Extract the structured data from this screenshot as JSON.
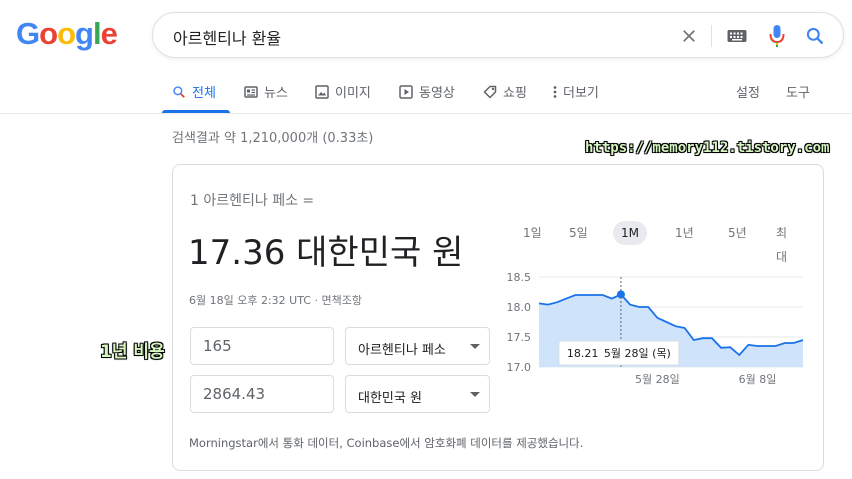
{
  "logo": {
    "letters": [
      "G",
      "o",
      "o",
      "g",
      "l",
      "e"
    ],
    "colors": [
      "#4285f4",
      "#ea4335",
      "#fbbc05",
      "#4285f4",
      "#34a853",
      "#ea4335"
    ]
  },
  "search": {
    "query": "아르헨티나 환율"
  },
  "tabs": [
    {
      "label": "전체",
      "icon": "search-icon",
      "active": true
    },
    {
      "label": "뉴스",
      "icon": "news-icon"
    },
    {
      "label": "이미지",
      "icon": "image-icon"
    },
    {
      "label": "동영상",
      "icon": "video-icon"
    },
    {
      "label": "쇼핑",
      "icon": "tag-icon"
    },
    {
      "label": "더보기",
      "icon": "more-vert-icon"
    },
    {
      "label": "설정"
    },
    {
      "label": "도구"
    }
  ],
  "stats": "검색결과 약 1,210,000개 (0.33초)",
  "watermark": "https://memory112.tistory.com",
  "side_label": "1년 비용",
  "converter": {
    "from_label": "1 아르헨티나 페소 =",
    "result": "17.36 대한민국 원",
    "timestamp": "6월 18일 오후 2:32 UTC · 면책조항",
    "amount_from": "165",
    "currency_from": "아르헨티나 페소",
    "amount_to": "2864.43",
    "currency_to": "대한민국 원",
    "footnote": "Morningstar에서 통화 데이터, Coinbase에서 암호화폐 데이터를 제공했습니다."
  },
  "ranges": [
    "1일",
    "5일",
    "1M",
    "1년",
    "5년",
    "최대"
  ],
  "chart_data": {
    "type": "area",
    "y_ticks": [
      "18.5",
      "18.0",
      "17.5",
      "17.0"
    ],
    "ylim": [
      17.0,
      18.5
    ],
    "x_ticks": [
      {
        "label": "5월 28일",
        "index": 13
      },
      {
        "label": "6월 8일",
        "index": 24
      }
    ],
    "values": [
      18.06,
      18.04,
      18.08,
      18.14,
      18.2,
      18.2,
      18.2,
      18.2,
      18.14,
      18.21,
      18.04,
      18.0,
      18.0,
      17.82,
      17.75,
      17.68,
      17.65,
      17.45,
      17.48,
      17.48,
      17.32,
      17.33,
      17.2,
      17.37,
      17.35,
      17.35,
      17.35,
      17.4,
      17.4,
      17.45
    ],
    "highlight_index": 9,
    "tooltip_value": "18.21",
    "tooltip_date": "5월 28일 (목)",
    "line_color": "#1a73e8",
    "fill_color": "#cfe3fb"
  }
}
